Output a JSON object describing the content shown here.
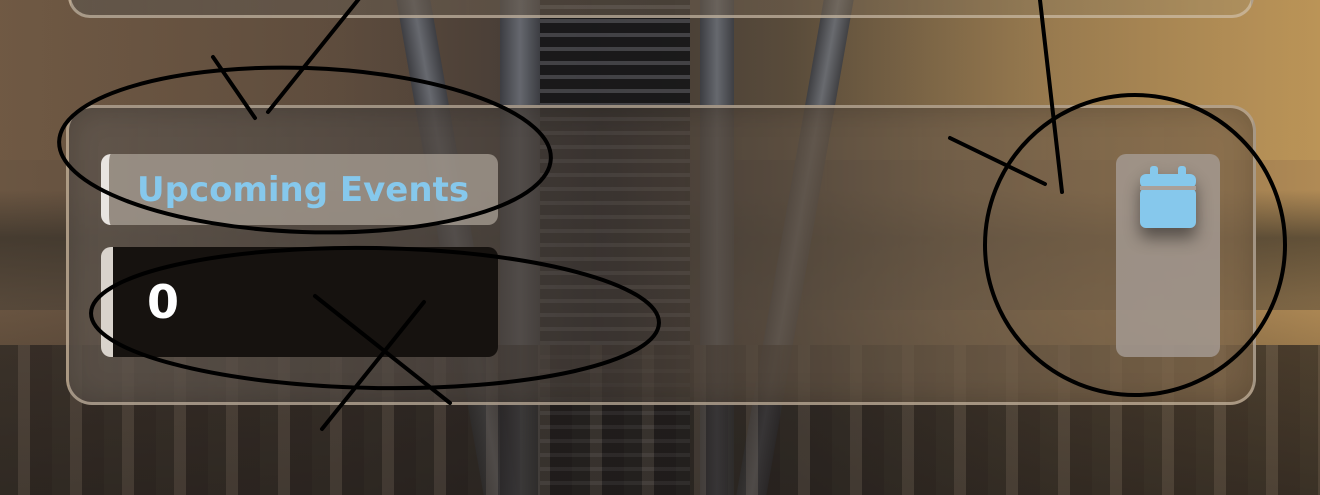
{
  "widget": {
    "title": "Upcoming Events",
    "value": "0",
    "icon": "calendar-icon"
  },
  "colors": {
    "title_text": "#86c8ec",
    "icon": "#86c8ec",
    "value_text": "#ffffff",
    "value_background": "#16120f"
  },
  "annotations": {
    "marks": [
      "ellipse-around-title",
      "ellipse-around-value",
      "circle-around-icon",
      "arrow-to-title",
      "cross-on-value",
      "arrow-to-icon"
    ]
  }
}
